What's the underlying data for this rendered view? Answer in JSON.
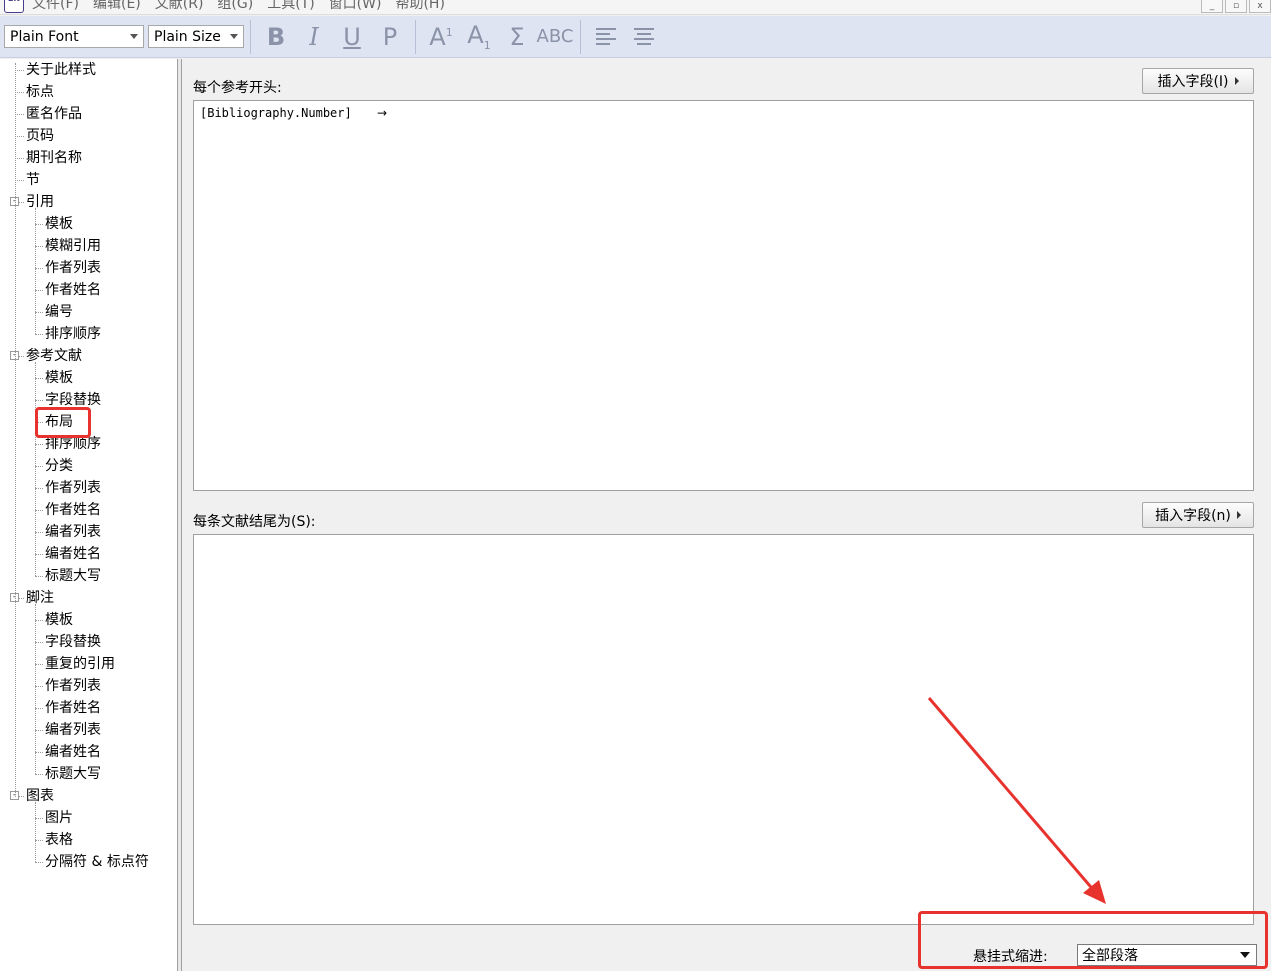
{
  "menubar": {
    "app_icon_text": "EN",
    "items": [
      "文件(F)",
      "编辑(E)",
      "文献(R)",
      "组(G)",
      "工具(T)",
      "窗口(W)",
      "帮助(H)"
    ],
    "window_buttons": [
      "_",
      "▫",
      "x"
    ]
  },
  "toolbar": {
    "font_select": "Plain Font",
    "size_select": "Plain Size",
    "bold": "B",
    "italic": "I",
    "underline": "U",
    "plain": "P",
    "superscript_base": "A",
    "superscript_mark": "1",
    "subscript_base": "A",
    "subscript_mark": "1",
    "symbol": "Σ",
    "smallcaps": "ABC"
  },
  "tree": {
    "items": [
      {
        "label": "关于此样式",
        "level": 0
      },
      {
        "label": "标点",
        "level": 0
      },
      {
        "label": "匿名作品",
        "level": 0
      },
      {
        "label": "页码",
        "level": 0
      },
      {
        "label": "期刊名称",
        "level": 0
      },
      {
        "label": "节",
        "level": 0
      },
      {
        "label": "引用",
        "level": 0,
        "expander": "-"
      },
      {
        "label": "模板",
        "level": 1
      },
      {
        "label": "模糊引用",
        "level": 1
      },
      {
        "label": "作者列表",
        "level": 1
      },
      {
        "label": "作者姓名",
        "level": 1
      },
      {
        "label": "编号",
        "level": 1
      },
      {
        "label": "排序顺序",
        "level": 1
      },
      {
        "label": "参考文献",
        "level": 0,
        "expander": "-"
      },
      {
        "label": "模板",
        "level": 1
      },
      {
        "label": "字段替换",
        "level": 1
      },
      {
        "label": "布局",
        "level": 1,
        "highlighted": true
      },
      {
        "label": "排序顺序",
        "level": 1
      },
      {
        "label": "分类",
        "level": 1
      },
      {
        "label": "作者列表",
        "level": 1
      },
      {
        "label": "作者姓名",
        "level": 1
      },
      {
        "label": "编者列表",
        "level": 1
      },
      {
        "label": "编者姓名",
        "level": 1
      },
      {
        "label": "标题大写",
        "level": 1
      },
      {
        "label": "脚注",
        "level": 0,
        "expander": "-"
      },
      {
        "label": "模板",
        "level": 1
      },
      {
        "label": "字段替换",
        "level": 1
      },
      {
        "label": "重复的引用",
        "level": 1
      },
      {
        "label": "作者列表",
        "level": 1
      },
      {
        "label": "作者姓名",
        "level": 1
      },
      {
        "label": "编者列表",
        "level": 1
      },
      {
        "label": "编者姓名",
        "level": 1
      },
      {
        "label": "标题大写",
        "level": 1
      },
      {
        "label": "图表",
        "level": 0,
        "expander": "-"
      },
      {
        "label": "图片",
        "level": 1
      },
      {
        "label": "表格",
        "level": 1
      },
      {
        "label": "分隔符 & 标点符",
        "level": 1
      }
    ]
  },
  "content": {
    "start_label": "每个参考开头:",
    "insert_field_1": "插入字段(I)",
    "start_text": "[Bibliography.Number]",
    "start_arrow": "→",
    "end_label": "每条文献结尾为(S):",
    "insert_field_2": "插入字段(n)",
    "end_text": "",
    "hanging_indent_label": "悬挂式缩进:",
    "hanging_indent_value": "全部段落"
  },
  "colors": {
    "annotation_red": "#e8322d",
    "toolbar_bg": "#dfe4f3"
  }
}
